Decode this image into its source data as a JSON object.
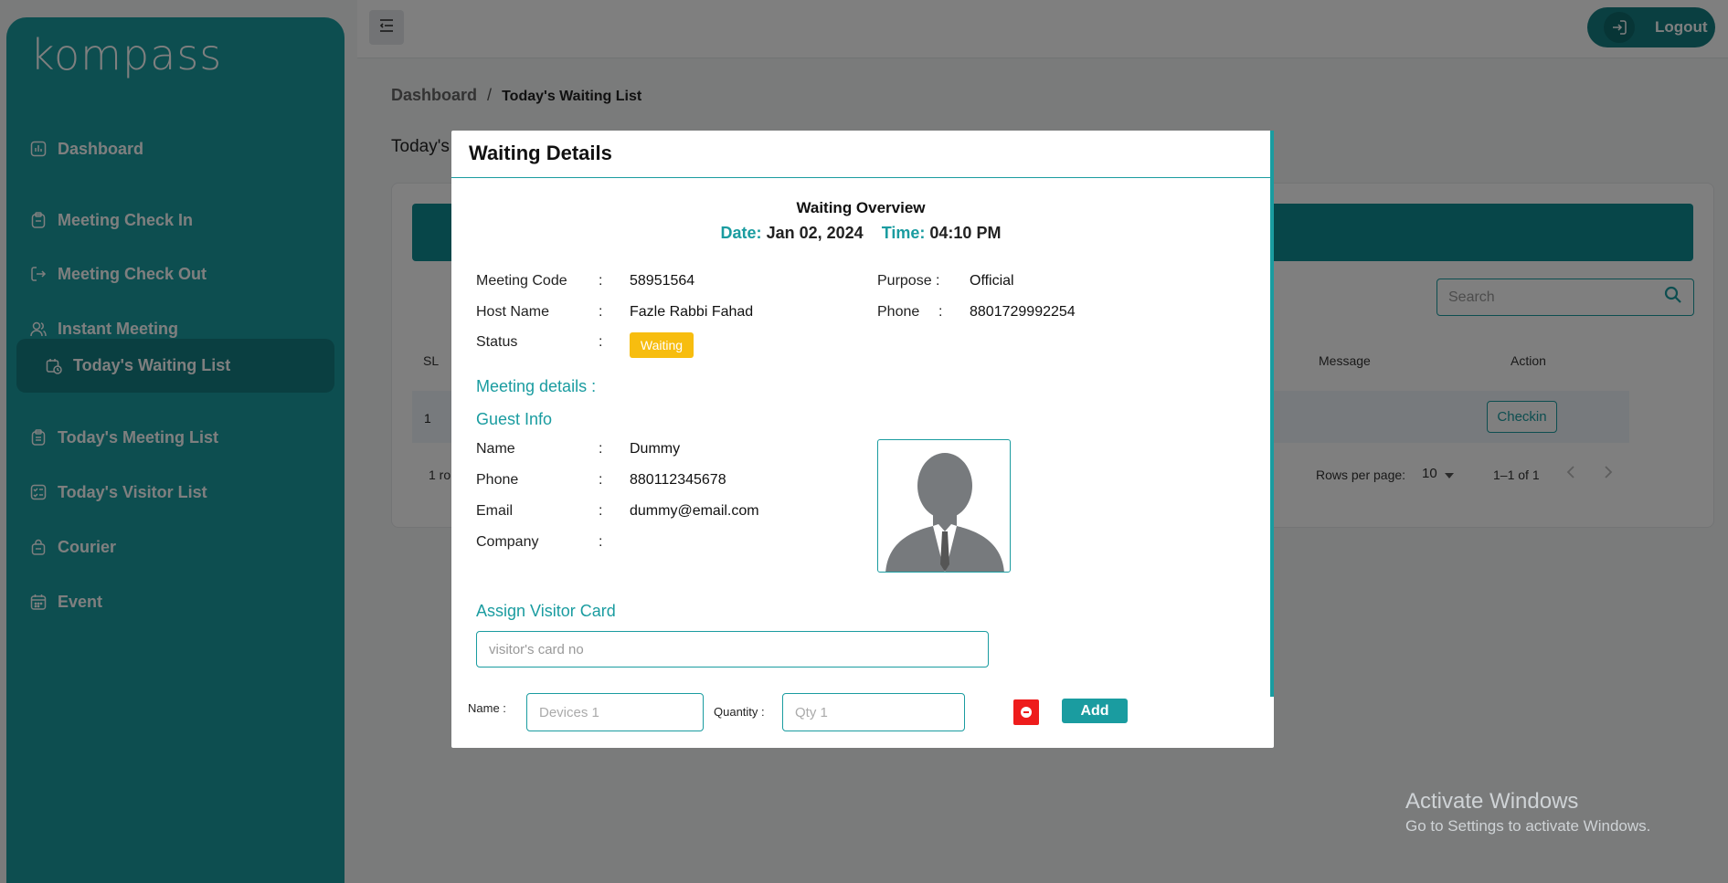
{
  "app": {
    "logo_text": "kompass"
  },
  "sidebar": {
    "items": [
      {
        "label": "Dashboard",
        "icon": "dashboard-icon"
      },
      {
        "label": "Meeting Check In",
        "icon": "clipboard-icon"
      },
      {
        "label": "Meeting Check Out",
        "icon": "logout-arrow-icon"
      },
      {
        "label": "Instant Meeting",
        "icon": "users-icon"
      },
      {
        "label": "Today's Waiting List",
        "icon": "calendar-clock-icon",
        "active": true
      },
      {
        "label": "Today's Meeting List",
        "icon": "clipboard-list-icon"
      },
      {
        "label": "Today's Visitor List",
        "icon": "checklist-icon"
      },
      {
        "label": "Courier",
        "icon": "bag-icon"
      },
      {
        "label": "Event",
        "icon": "calendar-icon"
      }
    ]
  },
  "header": {
    "logout_label": "Logout"
  },
  "breadcrumb": {
    "root": "Dashboard",
    "separator": "/",
    "current": "Today's Waiting List"
  },
  "page": {
    "title": "Today's"
  },
  "table": {
    "search_placeholder": "Search",
    "columns": {
      "sl": "SL",
      "message": "Message",
      "action": "Action"
    },
    "rows": [
      {
        "sl": "1",
        "action_label": "Checkin"
      }
    ],
    "footer": {
      "rows_text": "1 ro",
      "rows_per_page_label": "Rows per page:",
      "rows_per_page_value": "10",
      "range": "1–1 of 1"
    }
  },
  "watermark": {
    "line1": "Activate Windows",
    "line2": "Go to Settings to activate Windows."
  },
  "modal": {
    "title": "Waiting Details",
    "overview_title": "Waiting Overview",
    "date_label": "Date:",
    "date_value": "Jan 02, 2024",
    "time_label": "Time:",
    "time_value": "04:10 PM",
    "meeting_code_label": "Meeting Code",
    "meeting_code": "58951564",
    "host_name_label": "Host Name",
    "host_name": "Fazle Rabbi Fahad",
    "status_label": "Status",
    "status": "Waiting",
    "purpose_label": "Purpose :",
    "purpose": "Official",
    "phone_label": "Phone",
    "phone": "8801729992254",
    "colon": ":",
    "meeting_details_label": "Meeting details :",
    "guest_info_label": "Guest Info",
    "guest": {
      "name_label": "Name",
      "name": "Dummy",
      "phone_label": "Phone",
      "phone": "880112345678",
      "email_label": "Email",
      "email": "dummy@email.com",
      "company_label": "Company",
      "company": ""
    },
    "assign_card_label": "Assign Visitor Card",
    "card_placeholder": "visitor's card no",
    "device_name_label": "Name :",
    "device_placeholder": "Devices 1",
    "quantity_label": "Quantity :",
    "qty_placeholder": "Qty 1",
    "add_label": "Add"
  },
  "colors": {
    "primary": "#1a9ca0",
    "primary_dark": "#157f83",
    "badge_waiting": "#f7bd0f",
    "remove": "#ee1c1c"
  }
}
